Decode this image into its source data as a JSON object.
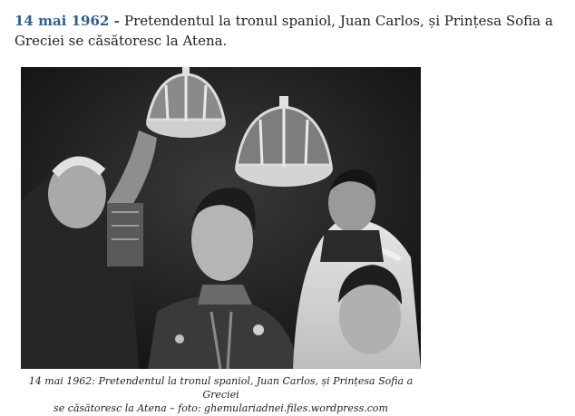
{
  "entry": {
    "date": "14 mai 1962",
    "separator": " - ",
    "text": "Pretendentul la tronul spaniol, Juan Carlos, și Prințesa Sofia a Greciei se căsătoresc la Atena."
  },
  "photo": {
    "style": "black-and-white"
  },
  "caption": {
    "line1": "14 mai 1962: Pretendentul la tronul spaniol, Juan Carlos, și Prințesa Sofia a Greciei",
    "line2": "se căsătoresc la Atena – foto: ghemulariadnei.files.wordpress.com"
  }
}
